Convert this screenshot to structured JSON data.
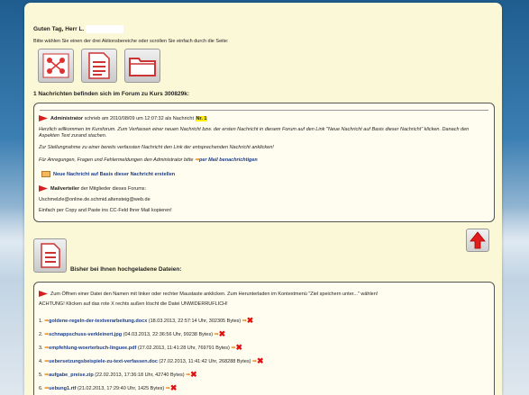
{
  "greeting": "Guten Tag, Herr L.",
  "hint": "Bitte wählen Sie einen der drei Aktionsbereiche oder scrollen Sie einfach durch die Seite:",
  "icons": [
    "people-network-icon",
    "document-icon",
    "folder-icon"
  ],
  "forum_heading": "1 Nachrichten befinden sich im Forum zu Kurs 300829k:",
  "post": {
    "author": "Administrator",
    "meta": "schrieb am 2010/08/09 um 12:07:32 als Nachricht",
    "number": "Nr. 1",
    "text1": "Herzlich willkommen im Kursforum. Zum Verfassen einer neuen Nachricht bzw. der ersten Nachricht in diesem Forum auf den Link \"Neue Nachricht auf Basis dieser Nachricht\" klicken. Danach den",
    "text2": "Aspekten Text zurand stachen.",
    "text3": "Zur Stellungnahme zu einer bereits verfassten Nachricht den Link der entsprechenden Nachricht anklicken!",
    "text4": "Für Anregungen, Fragen und Fehlermeldungen den Administrator bitte",
    "notify_link": "per Mail benachrichtigen",
    "new_msg_link": "Neue Nachricht auf Basis dieser Nachricht erstellen",
    "mail_label": "Mailverteiler",
    "mail_rest": "der Mitglieder dieses Forums:",
    "mail_addresses": "Uschmelzle@online.de.schmid.altensteig@web.de",
    "mail_hint": "Einfach per Copy and Paste ins CC-Feld Ihrer Mail kopieren!"
  },
  "files_heading": "Bisher bei Ihnen hochgeladene Dateien:",
  "files_hint": "Zum Öffnen einer Datei den Namen mit linker oder rechter Maustaste anklicken. Zum Herunterladen im Kontextmenü \"Ziel speichern unter...\" wählen!",
  "files_warning": "ACHTUNG! Klicken auf das rote X rechts außen löscht die Datei UNWIDERRUFLICH!",
  "files": [
    {
      "n": "1.",
      "name": "goldene-regeln-der-textverarbeitung.docx",
      "meta": "(18.03.2013, 22:57:14 Uhr, 302305 Bytes)"
    },
    {
      "n": "2.",
      "name": "schnappschuss-verkleinert.jpg",
      "meta": "(04.03.2013, 22:36:56 Uhr, 99238 Bytes)"
    },
    {
      "n": "3.",
      "name": "empfehlung-woerterbuch-linguee.pdf",
      "meta": "(27.02.2013, 11:41:28 Uhr, 769791 Bytes)"
    },
    {
      "n": "4.",
      "name": "uebersetzungsbeispiele-zu-text-verfassen.doc",
      "meta": "(27.02.2013, 11:41:42 Uhr, 268288 Bytes)"
    },
    {
      "n": "5.",
      "name": "aufgabe_preise.zip",
      "meta": "(22.02.2013, 17:36:18 Uhr, 42740 Bytes)"
    },
    {
      "n": "6.",
      "name": "uebung1.rtf",
      "meta": "(21.02.2013, 17:29:40 Uhr, 1425 Bytes)"
    }
  ],
  "colors": {
    "panel": "#fbf8d8",
    "highlight": "#ffef00",
    "link": "#1a3c8c",
    "delete": "#e01010"
  }
}
